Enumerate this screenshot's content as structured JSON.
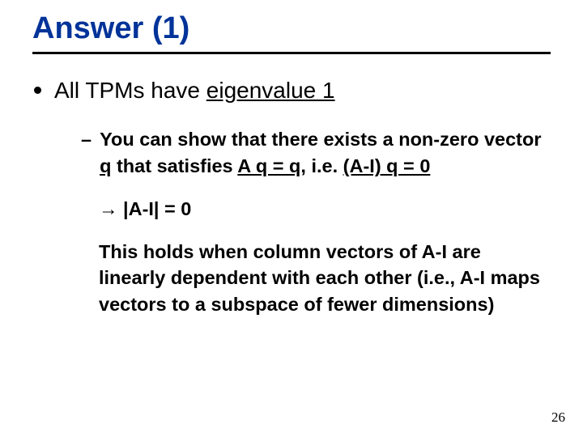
{
  "slide": {
    "title": "Answer (1)",
    "bullet1_prefix": "All TPMs have ",
    "bullet1_underlined": "eigenvalue 1",
    "sub_prefix": "You can show that there exists a non-zero vector ",
    "sub_q1": "q",
    "sub_mid1": " that satisfies ",
    "sub_eq": "A q = q",
    "sub_mid2": ", i.e. ",
    "sub_eq2": "(A-I) q = 0",
    "implication": "→ |A-I| = 0",
    "conclusion": "This holds when column vectors of A-I are linearly dependent with each other (i.e., A-I maps vectors to a subspace of fewer dimensions)",
    "page_number": "26"
  }
}
